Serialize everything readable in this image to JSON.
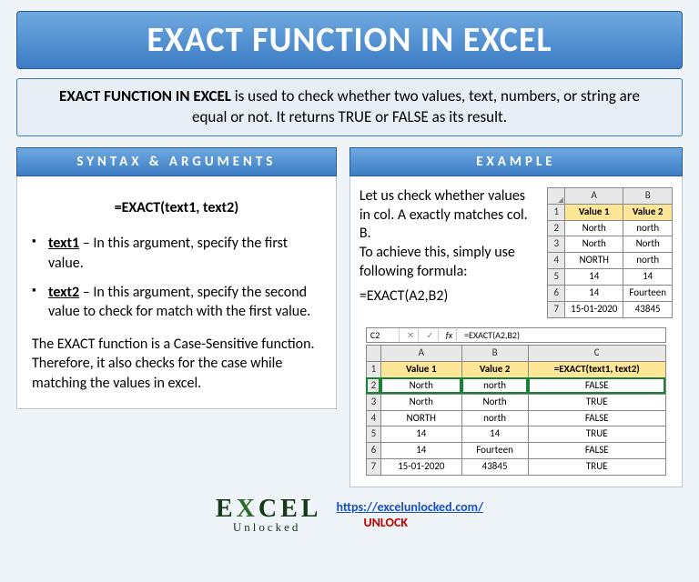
{
  "title": "EXACT FUNCTION IN EXCEL",
  "description": {
    "lead": "EXACT FUNCTION IN EXCEL",
    "rest": " is used to check whether two values, text, numbers, or string are equal or not. It returns TRUE or FALSE as its result."
  },
  "syntax": {
    "heading": "SYNTAX & ARGUMENTS",
    "formula": "=EXACT(text1, text2)",
    "args": [
      {
        "name": "text1",
        "desc": " – In this argument, specify the first value."
      },
      {
        "name": "text2",
        "desc": " – In this argument, specify the second value to check for match with the first value."
      }
    ],
    "note": "The EXACT function is a Case-Sensitive function. Therefore, it also checks for the case while matching the values in excel."
  },
  "example": {
    "heading": "EXAMPLE",
    "intro": "Let us check whether values in col. A exactly matches col. B.\nTo achieve this, simply use following formula:",
    "formula": "=EXACT(A2,B2)",
    "table1": {
      "cols": [
        "A",
        "B"
      ],
      "headers": [
        "Value 1",
        "Value 2"
      ],
      "rows": [
        [
          "North",
          "north"
        ],
        [
          "North",
          "North"
        ],
        [
          "NORTH",
          "north"
        ],
        [
          "14",
          "14"
        ],
        [
          "14",
          "Fourteen"
        ],
        [
          "15-01-2020",
          "43845"
        ]
      ]
    },
    "formula_bar": {
      "ref": "C2",
      "text": "=EXACT(A2,B2)"
    },
    "table2": {
      "cols": [
        "A",
        "B",
        "C"
      ],
      "headers": [
        "Value 1",
        "Value 2",
        "=EXACT(text1, text2)"
      ],
      "rows": [
        [
          "North",
          "north",
          "FALSE"
        ],
        [
          "North",
          "North",
          "TRUE"
        ],
        [
          "NORTH",
          "north",
          "FALSE"
        ],
        [
          "14",
          "14",
          "TRUE"
        ],
        [
          "14",
          "Fourteen",
          "FALSE"
        ],
        [
          "15-01-2020",
          "43845",
          "TRUE"
        ]
      ]
    }
  },
  "footer": {
    "logo_top": "EXCEL",
    "logo_sub": "Unlocked",
    "url": "https://excelunlocked.com/",
    "unlock": "UNLOCK"
  }
}
